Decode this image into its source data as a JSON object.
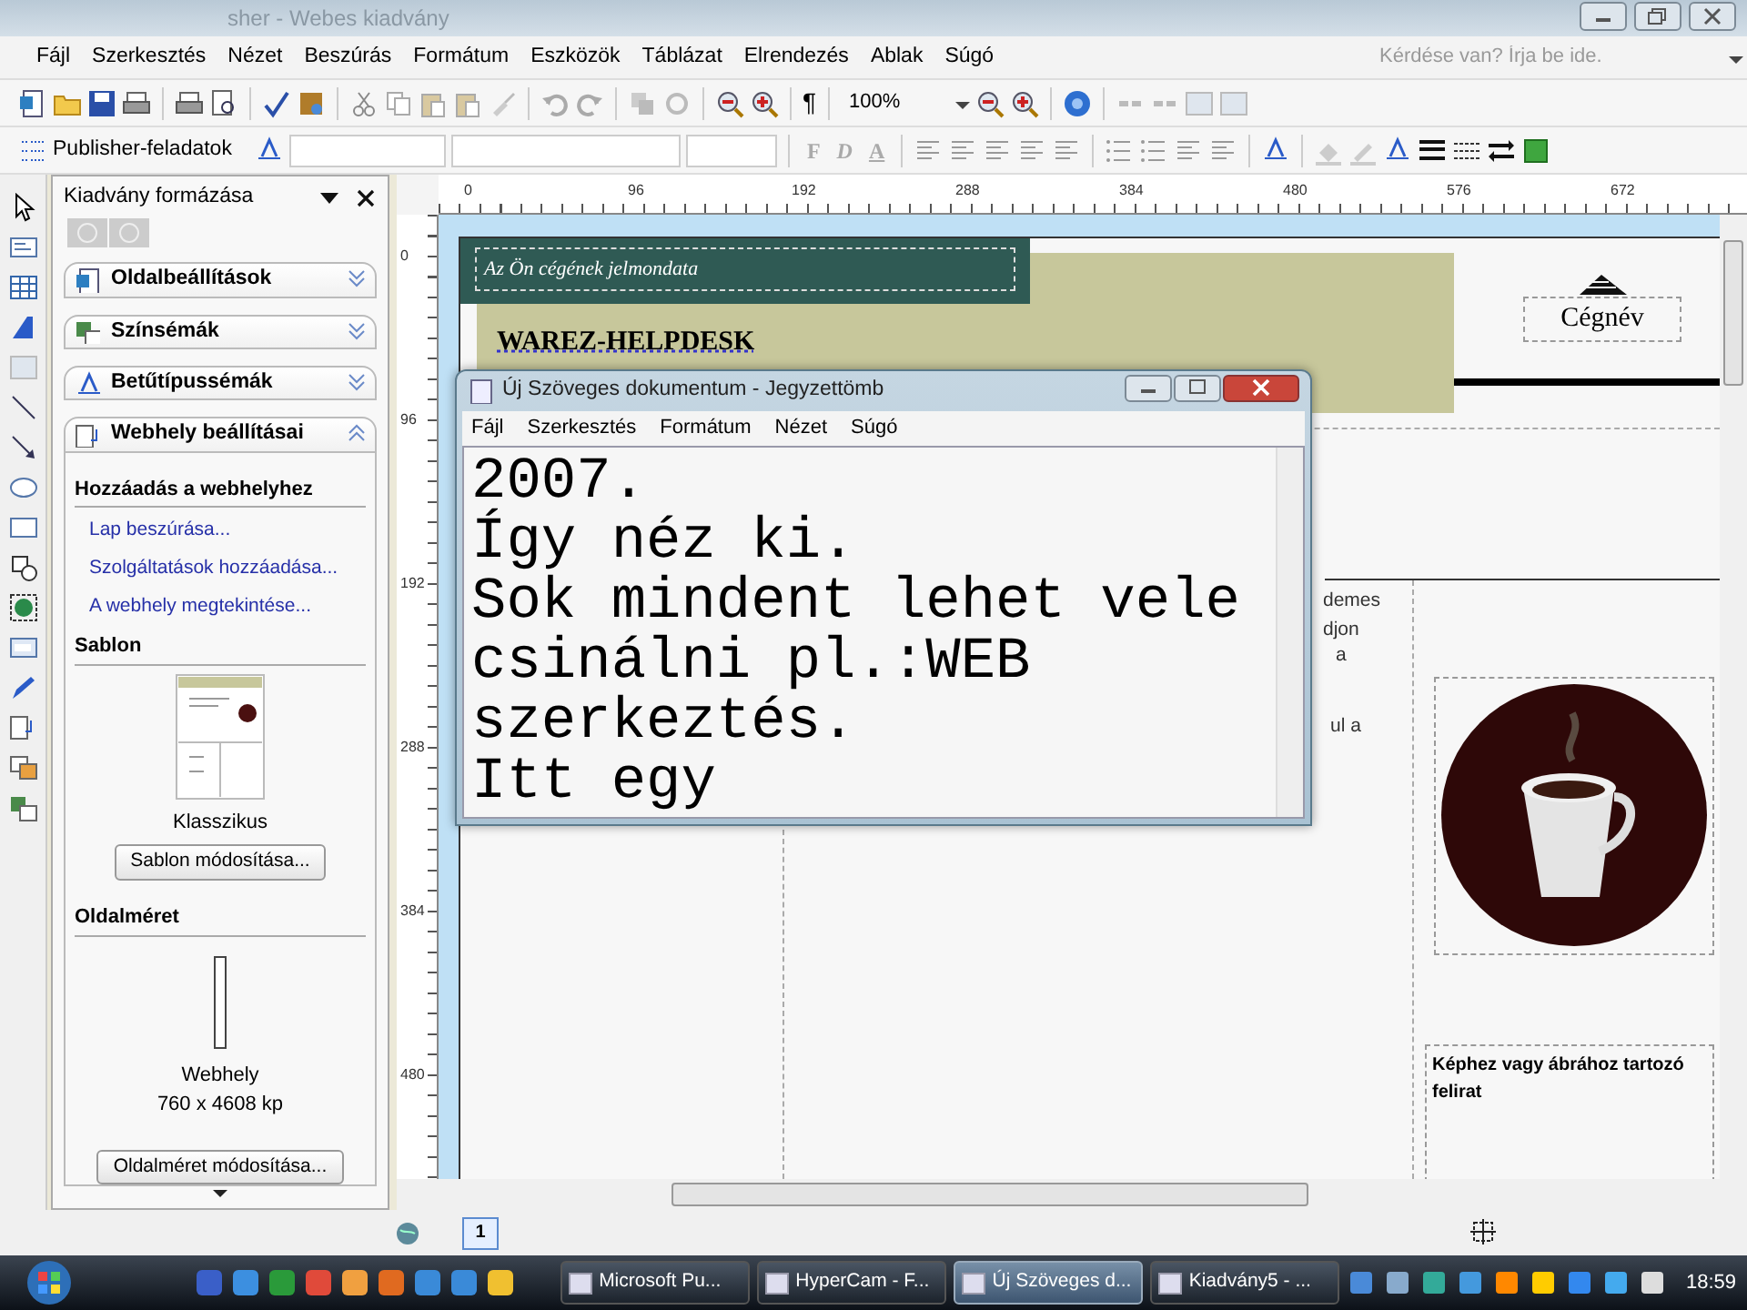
{
  "window": {
    "title": "sher - Webes kiadvány"
  },
  "menu": [
    "Fájl",
    "Szerkesztés",
    "Nézet",
    "Beszúrás",
    "Formátum",
    "Eszközök",
    "Táblázat",
    "Elrendezés",
    "Ablak",
    "Súgó"
  ],
  "help_search": {
    "placeholder": "Kérdése van? Írja be ide."
  },
  "toolbar": {
    "pilcrow": "¶",
    "zoom": "100%"
  },
  "format_toolbar": {
    "task_button": "Publisher-feladatok",
    "style_buttons": [
      {
        "label": "F",
        "disabled": true
      },
      {
        "label": "D",
        "disabled": true
      },
      {
        "label": "A",
        "disabled": true
      }
    ]
  },
  "task_pane": {
    "title": "Kiadvány formázása",
    "sections": [
      {
        "label": "Oldalbeállítások",
        "expanded": false
      },
      {
        "label": "Színsémák",
        "expanded": false
      },
      {
        "label": "Betűtípussémák",
        "expanded": false
      },
      {
        "label": "Webhely beállításai",
        "expanded": true
      }
    ],
    "add_heading": "Hozzáadás a webhelyhez",
    "links": [
      "Lap beszúrása...",
      "Szolgáltatások hozzáadása...",
      "A webhely megtekintése..."
    ],
    "template_heading": "Sablon",
    "template_name": "Klasszikus",
    "template_button": "Sablon módosítása...",
    "size_heading": "Oldalméret",
    "size_name": "Webhely",
    "size_value": "760 x 4608 kp",
    "size_button": "Oldalméret módosítása..."
  },
  "ruler": {
    "horizontal": [
      "0",
      "96",
      "192",
      "288",
      "384",
      "480",
      "576",
      "672"
    ],
    "vertical": [
      "0",
      "96",
      "192",
      "288",
      "384",
      "480"
    ]
  },
  "canvas": {
    "tagline": "Az Ön cégének jelmondata",
    "site_name": "WAREZ-HELPDESK",
    "logo_text": "Cégnév",
    "fragments": [
      "demes",
      "djon",
      "a",
      "ul a"
    ],
    "picture": {
      "kind": "picture"
    },
    "caption": "Képhez vagy ábrához tartozó felirat"
  },
  "page_nav": {
    "pages": [
      {
        "label": "1",
        "selected": true
      }
    ]
  },
  "notepad": {
    "title": "Új Szöveges dokumentum - Jegyzettömb",
    "menu": [
      "Fájl",
      "Szerkesztés",
      "Formátum",
      "Nézet",
      "Súgó"
    ],
    "text_lines": [
      "2007.",
      "Így néz ki.",
      "Sok mindent lehet vele",
      "csinálni pl.:WEB",
      "szerkeztés.",
      "Itt egy"
    ]
  },
  "taskbar": {
    "buttons": [
      {
        "label": "Microsoft Pu...",
        "selected": false
      },
      {
        "label": "HyperCam - F...",
        "selected": false
      },
      {
        "label": "Új Szöveges d...",
        "selected": true
      },
      {
        "label": "Kiadvány5 - ...",
        "selected": false
      }
    ],
    "clock": "18:59"
  }
}
